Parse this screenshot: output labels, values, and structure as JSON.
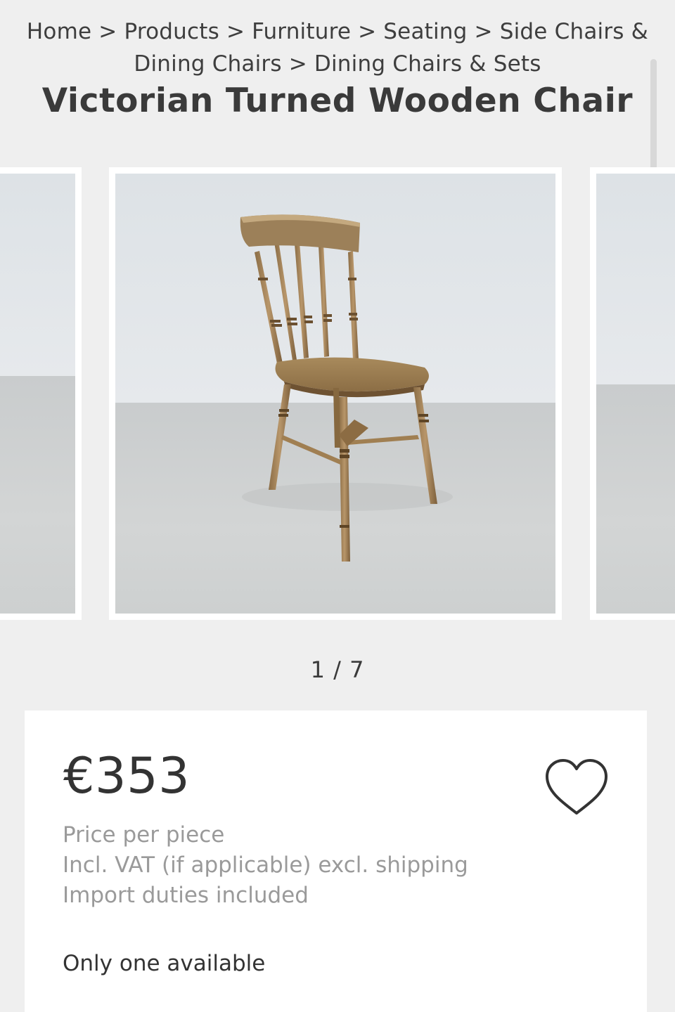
{
  "breadcrumb": {
    "items": [
      "Home",
      "Products",
      "Furniture",
      "Seating",
      "Side Chairs &",
      "Dining Chairs",
      "Dining Chairs & Sets"
    ],
    "separator": ">"
  },
  "product": {
    "title": "Victorian Turned Wooden Chair"
  },
  "gallery": {
    "counter": "1 / 7",
    "current": 1,
    "total": 7
  },
  "pricing": {
    "price": "€353",
    "details": [
      "Price per piece",
      "Incl. VAT (if applicable) excl. shipping",
      "Import duties included"
    ],
    "availability": "Only one available"
  },
  "icons": {
    "favorite": "heart-outline-icon"
  },
  "colors": {
    "background": "#efefef",
    "card": "#ffffff",
    "text": "#3a3a3a",
    "muted": "#9a9a9a"
  }
}
